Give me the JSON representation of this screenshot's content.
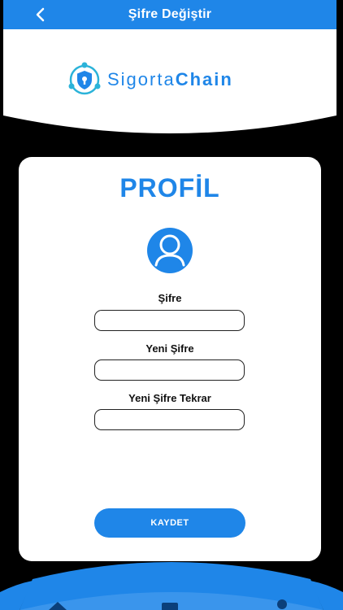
{
  "nav": {
    "title": "Şifre Değiştir"
  },
  "logo": {
    "text_light": "Sigorta",
    "text_bold": "Chain"
  },
  "card": {
    "title": "PROFİL",
    "fields": [
      {
        "label": "Şifre",
        "value": "",
        "placeholder": ""
      },
      {
        "label": "Yeni Şifre",
        "value": "",
        "placeholder": ""
      },
      {
        "label": "Yeni Şifre Tekrar",
        "value": "",
        "placeholder": ""
      }
    ],
    "save_label": "KAYDET"
  },
  "colors": {
    "accent": "#1f86e8",
    "background": "#000000",
    "card": "#ffffff"
  },
  "tabbar": {
    "icons": [
      "home-icon",
      "card-icon",
      "user-icon"
    ]
  }
}
